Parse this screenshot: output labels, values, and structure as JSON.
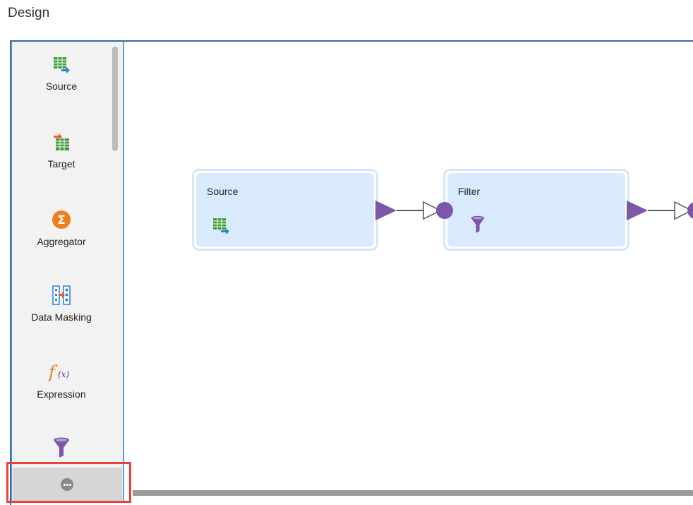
{
  "header": {
    "title": "Design"
  },
  "palette": {
    "items": [
      {
        "label": "Source",
        "icon": "source-table-icon"
      },
      {
        "label": "Target",
        "icon": "target-table-icon"
      },
      {
        "label": "Aggregator",
        "icon": "aggregator-sigma-icon"
      },
      {
        "label": "Data Masking",
        "icon": "data-masking-icon"
      },
      {
        "label": "Expression",
        "icon": "expression-fx-icon"
      },
      {
        "label": "",
        "icon": "filter-funnel-icon"
      }
    ],
    "more_icon": "more-ellipsis-icon"
  },
  "canvas": {
    "nodes": [
      {
        "title": "Source",
        "icon": "source-table-icon"
      },
      {
        "title": "Filter",
        "icon": "filter-funnel-icon"
      }
    ]
  },
  "colors": {
    "accent_blue": "#2f6ea8",
    "node_fill": "#d8eafb",
    "port_purple": "#7b57a8",
    "highlight_red": "#e8423f",
    "aggregator_orange": "#f07d1a"
  }
}
